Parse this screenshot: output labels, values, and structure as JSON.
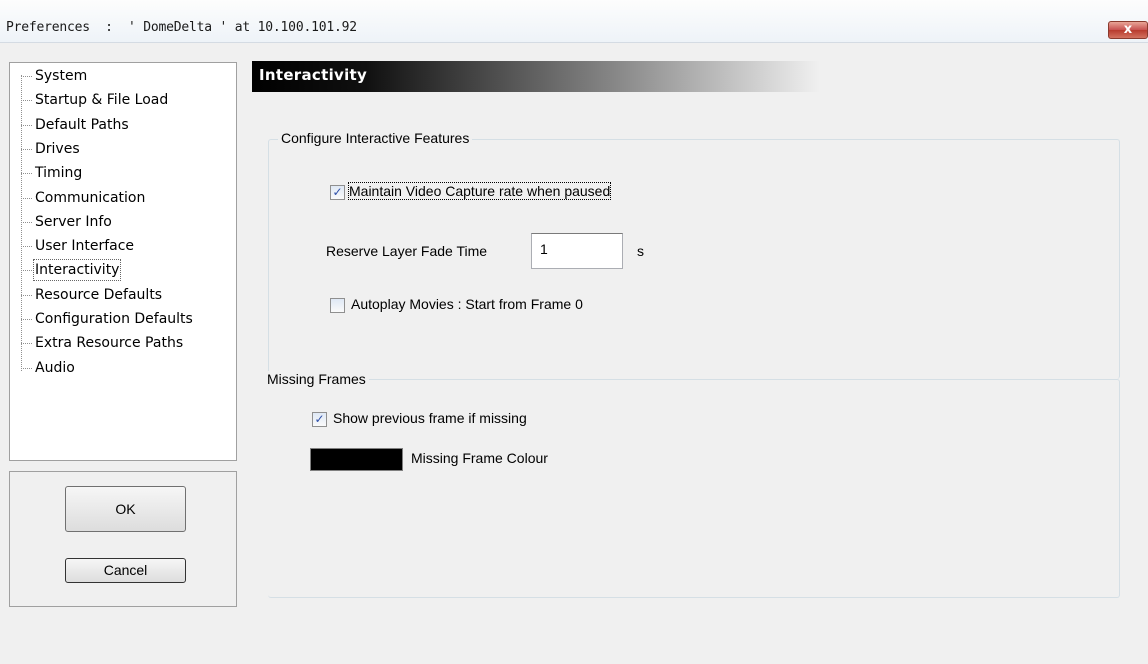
{
  "window": {
    "title": "Preferences  :  ' DomeDelta ' at 10.100.101.92",
    "close_glyph": "x"
  },
  "tree": {
    "items": [
      {
        "label": "System"
      },
      {
        "label": "Startup & File Load"
      },
      {
        "label": "Default Paths"
      },
      {
        "label": "Drives"
      },
      {
        "label": "Timing"
      },
      {
        "label": "Communication"
      },
      {
        "label": "Server Info"
      },
      {
        "label": "User Interface"
      },
      {
        "label": "Interactivity"
      },
      {
        "label": "Resource Defaults"
      },
      {
        "label": "Configuration Defaults"
      },
      {
        "label": "Extra Resource Paths"
      },
      {
        "label": "Audio"
      }
    ],
    "selected": "Interactivity"
  },
  "buttons": {
    "ok_label": "OK",
    "cancel_label": "Cancel"
  },
  "section": {
    "heading": "Interactivity"
  },
  "interactive_features": {
    "legend": "Configure Interactive Features",
    "maintain_capture_label": "Maintain Video Capture rate when paused",
    "maintain_capture_checked": true,
    "fade_time_label": "Reserve Layer Fade Time",
    "fade_time_value": "1",
    "fade_time_unit": "s",
    "autoplay_label": "Autoplay Movies : Start from Frame 0",
    "autoplay_checked": false
  },
  "missing_frames": {
    "legend": "Missing Frames",
    "show_previous_label": "Show previous frame if missing",
    "show_previous_checked": true,
    "colour_label": "Missing Frame Colour",
    "colour_value": "#000000"
  },
  "check_glyph": "✓"
}
